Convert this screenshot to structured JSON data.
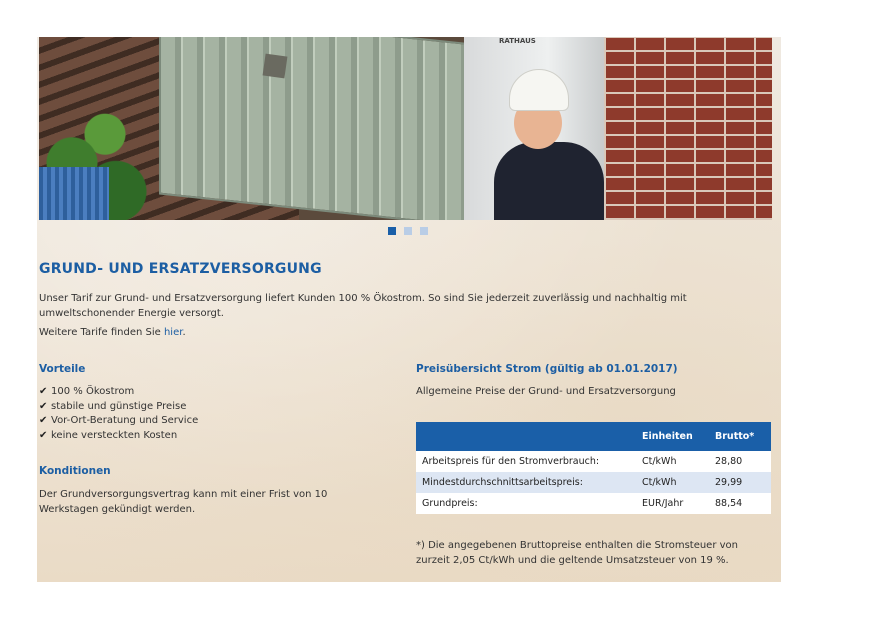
{
  "hero": {
    "door_sign": "RATHAUS",
    "slides": 3,
    "active_slide": 1
  },
  "page": {
    "title": "GRUND- UND ERSATZVERSORGUNG",
    "intro": "Unser Tarif zur Grund- und Ersatzversorgung liefert Kunden 100 % Ökostrom. So sind Sie jederzeit zuverlässig und nachhaltig mit umweltschonender Energie versorgt.",
    "more_prefix": "Weitere Tarife finden Sie ",
    "more_link": "hier",
    "more_suffix": "."
  },
  "vorteile": {
    "heading": "Vorteile",
    "items": [
      "100 % Ökostrom",
      "stabile und günstige Preise",
      "Vor-Ort-Beratung und Service",
      "keine versteckten Kosten"
    ]
  },
  "konditionen": {
    "heading": "Konditionen",
    "text": "Der Grundversorgungsvertrag kann mit einer Frist von 10 Werkstagen gekündigt werden."
  },
  "prices": {
    "heading": "Preisübersicht Strom (gültig ab 01.01.2017)",
    "subtitle": "Allgemeine Preise der Grund- und Ersatzversorgung",
    "columns": [
      "",
      "Einheiten",
      "Brutto*"
    ],
    "rows": [
      [
        "Arbeitspreis für den Stromverbrauch:",
        "Ct/kWh",
        "28,80"
      ],
      [
        "Mindestdurchschnittsarbeitspreis:",
        "Ct/kWh",
        "29,99"
      ],
      [
        "Grundpreis:",
        "EUR/Jahr",
        "88,54"
      ]
    ],
    "footnote": "*) Die angegebenen Bruttopreise enthalten die Stromsteuer von zurzeit 2,05 Ct/kWh und die geltende Umsatzsteuer von 19 %."
  },
  "colors": {
    "accent": "#1c5ea3",
    "table_header": "#1a5fa8",
    "row_alt": "#dde6f3"
  }
}
